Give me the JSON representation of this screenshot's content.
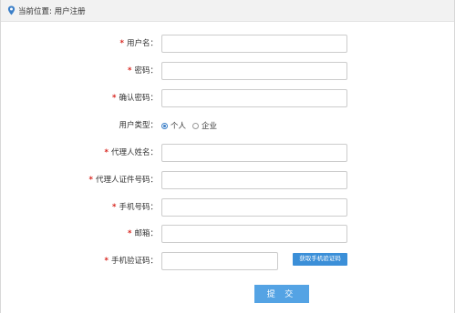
{
  "breadcrumb": {
    "icon": "location-pin-icon",
    "text": "当前位置: 用户注册"
  },
  "form": {
    "required_mark": "*",
    "fields": [
      {
        "label": "用户名：",
        "required": true,
        "value": ""
      },
      {
        "label": "密码：",
        "required": true,
        "value": ""
      },
      {
        "label": "确认密码：",
        "required": true,
        "value": ""
      },
      {
        "label": "代理人姓名：",
        "required": true,
        "value": ""
      },
      {
        "label": "代理人证件号码：",
        "required": true,
        "value": ""
      },
      {
        "label": "手机号码：",
        "required": true,
        "value": ""
      },
      {
        "label": "邮箱：",
        "required": true,
        "value": ""
      },
      {
        "label": "手机验证码：",
        "required": true,
        "value": ""
      }
    ],
    "user_type": {
      "label": "用户类型：",
      "options": [
        "个人",
        "企业"
      ],
      "selected": "个人"
    },
    "sms_button": "获取手机验证码",
    "submit_button": "提 交"
  },
  "colors": {
    "required": "#d8261f",
    "button": "#3b8fd8",
    "submit": "#54a3e4"
  }
}
